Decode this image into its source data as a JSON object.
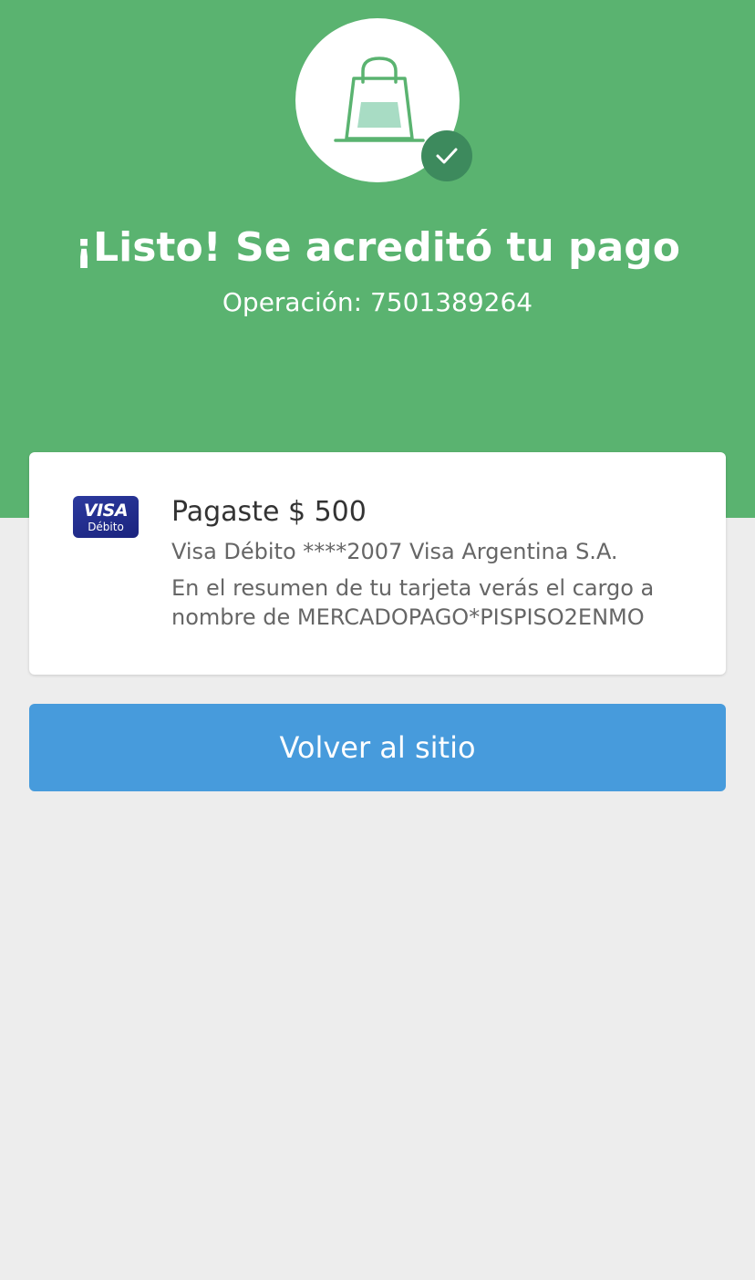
{
  "header": {
    "icon": "shopping-bag-icon",
    "badge_icon": "check-icon",
    "title": "¡Listo! Se acreditó tu pago",
    "operation": "Operación: 7501389264"
  },
  "payment": {
    "card_brand": "VISA",
    "card_type": "Débito",
    "paid_text": "Pagaste $ 500",
    "card_details": "Visa Débito ****2007 Visa Argentina S.A.",
    "statement_note": "En el resumen de tu tarjeta verás el cargo a nombre de MERCADOPAGO*PISPISO2ENMO"
  },
  "actions": {
    "back_label": "Volver al sitio"
  },
  "colors": {
    "hero_green": "#5ab370",
    "badge_green": "#3d8a5d",
    "button_blue": "#479bdc",
    "background": "#ededed"
  }
}
